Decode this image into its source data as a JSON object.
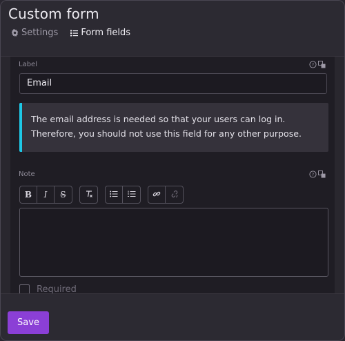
{
  "header": {
    "title": "Custom form",
    "tabs": [
      {
        "label": "Settings",
        "icon": "gear-icon",
        "active": false
      },
      {
        "label": "Form fields",
        "icon": "list-icon",
        "active": true
      }
    ]
  },
  "label_field": {
    "label": "Label",
    "value": "Email",
    "icons": [
      "help-icon",
      "translate-icon"
    ]
  },
  "callout": {
    "text": "The email address is needed so that your users can log in. Therefore, you should not use this field for any other purpose.",
    "accent_color": "#1ec8e6"
  },
  "note_field": {
    "label": "Note",
    "icons": [
      "help-icon",
      "translate-icon"
    ],
    "toolbar": {
      "bold": "B",
      "italic": "I",
      "strike": "S",
      "buttons": [
        "bold-icon",
        "italic-icon",
        "strikethrough-icon",
        "clear-format-icon",
        "bullet-list-icon",
        "numbered-list-icon",
        "link-icon",
        "unlink-icon"
      ]
    },
    "value": ""
  },
  "required": {
    "label": "Required",
    "checked": false
  },
  "footer": {
    "save_label": "Save",
    "save_color": "#8b3fd6"
  }
}
